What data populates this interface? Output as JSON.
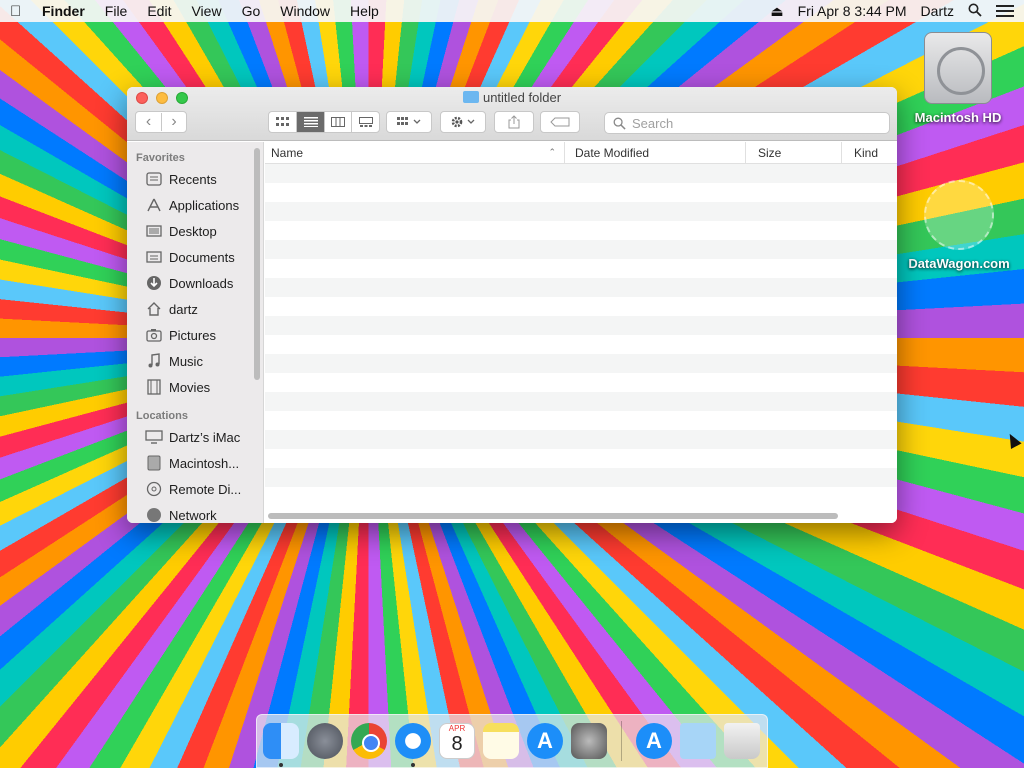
{
  "menubar": {
    "apple": "",
    "app_name": "Finder",
    "items": [
      "File",
      "Edit",
      "View",
      "Go",
      "Window",
      "Help"
    ],
    "eject": "⏏",
    "datetime": "Fri Apr 8  3:44 PM",
    "user": "Dartz"
  },
  "desktop": {
    "hd_label": "Macintosh HD",
    "watermark": "DataWagon.com"
  },
  "window": {
    "title": "untitled folder",
    "search_placeholder": "Search",
    "sidebar": {
      "favorites_header": "Favorites",
      "favorites": [
        {
          "label": "Recents",
          "icon": "recents-icon"
        },
        {
          "label": "Applications",
          "icon": "applications-icon"
        },
        {
          "label": "Desktop",
          "icon": "desktop-icon"
        },
        {
          "label": "Documents",
          "icon": "documents-icon"
        },
        {
          "label": "Downloads",
          "icon": "downloads-icon"
        },
        {
          "label": "dartz",
          "icon": "home-icon"
        },
        {
          "label": "Pictures",
          "icon": "pictures-icon"
        },
        {
          "label": "Music",
          "icon": "music-icon"
        },
        {
          "label": "Movies",
          "icon": "movies-icon"
        }
      ],
      "locations_header": "Locations",
      "locations": [
        {
          "label": "Dartz’s iMac",
          "icon": "imac-icon"
        },
        {
          "label": "Macintosh...",
          "icon": "disk-icon"
        },
        {
          "label": "Remote Di...",
          "icon": "remote-disc-icon"
        },
        {
          "label": "Network",
          "icon": "network-icon"
        }
      ]
    },
    "columns": {
      "name": "Name",
      "date_modified": "Date Modified",
      "size": "Size",
      "kind": "Kind"
    }
  },
  "dock": {
    "calendar_month": "APR",
    "calendar_day": "8",
    "appstore_glyph": "A",
    "apps": [
      "Finder",
      "Launchpad",
      "Google Chrome",
      "Safari",
      "Calendar",
      "Notes",
      "App Store",
      "System Preferences",
      "App Store",
      "Downloads",
      "Trash"
    ]
  },
  "colors": {
    "close": "#fc605c",
    "minimize": "#fdbc40",
    "maximize": "#34c84a",
    "active_view": "#6b6b6b"
  }
}
